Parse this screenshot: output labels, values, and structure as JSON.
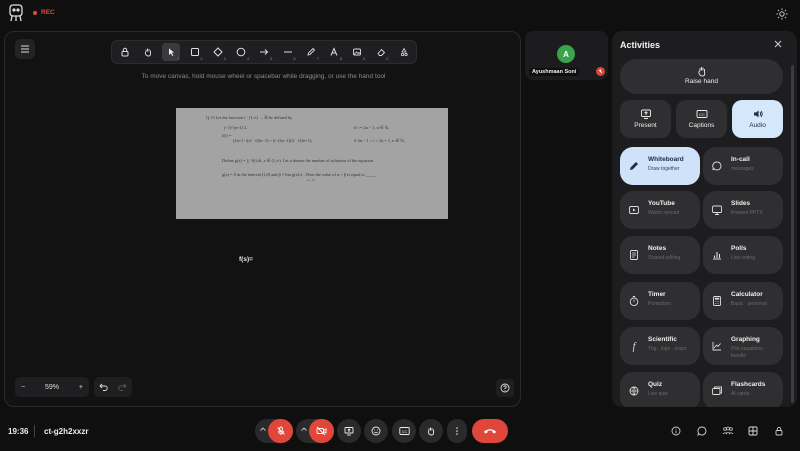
{
  "header": {
    "rec_label": "REC"
  },
  "canvas": {
    "hint": "To move canvas, hold mouse wheel or spacebar while dragging, or use the hand tool",
    "tool_numbers": [
      "",
      "",
      "1",
      "2",
      "3",
      "4",
      "5",
      "6",
      "7",
      "8",
      "9",
      "0",
      ""
    ],
    "selected_tool": "selection",
    "handwritten_text": "f(s)=",
    "zoom_level": "59%",
    "paper": {
      "line1": "Q.13   Let the function  f : [1,∞) → ℝ  be defined by",
      "line2a": "f(t) = ",
      "line2b": "(−1)^(n+1) 2,",
      "line2c": "if  t = 2n − 1,  n ∈ ℕ,",
      "line3a": "(2n+1−t)/2 · f(2n−1) + (t−(2n−1))/2 · f(2n+1),",
      "line3b": "if  2n − 1 < t < 2n + 1,  n ∈ ℕ.",
      "line4": "Define  g(x) = ∫₁ˣ f(t) dt,  x ∈ (1,∞).  Let  α  denote the number of solutions of the equation",
      "line5": "g(x) = 0  in the interval (1,8]  and   β = lim g(x)/x .  Then the value of  α + β  is equal to _____",
      "line5sub": "x→1+"
    }
  },
  "participant": {
    "initial": "A",
    "name": "Ayushmaan Soni"
  },
  "activities": {
    "title": "Activities",
    "raise_hand": "Raise hand",
    "quick": [
      {
        "label": "Present",
        "icon": "present-icon"
      },
      {
        "label": "Captions",
        "icon": "cc-icon"
      },
      {
        "label": "Audio",
        "icon": "speaker-icon"
      }
    ],
    "cards": [
      {
        "title": "Whiteboard",
        "sub": "Draw together",
        "icon": "pencil-icon"
      },
      {
        "title": "In-call",
        "sub": "messages",
        "icon": "chat-icon"
      },
      {
        "title": "YouTube",
        "sub": "Watch synced",
        "icon": "play-icon"
      },
      {
        "title": "Slides",
        "sub": "Present PPTX",
        "icon": "slides-icon"
      },
      {
        "title": "Notes",
        "sub": "Shared editing",
        "icon": "notes-icon"
      },
      {
        "title": "Polls",
        "sub": "Live voting",
        "icon": "bar-chart-icon"
      },
      {
        "title": "Timer",
        "sub": "Pomodoro",
        "icon": "timer-icon"
      },
      {
        "title": "Calculator",
        "sub": "Basic · personal",
        "icon": "calculator-icon"
      },
      {
        "title": "Scientific",
        "sub": "Trig · logs · exact",
        "icon": "function-icon"
      },
      {
        "title": "Graphing",
        "sub": "Plot equations · bundle",
        "icon": "graph-icon"
      },
      {
        "title": "Quiz",
        "sub": "Live quiz",
        "icon": "quiz-icon"
      },
      {
        "title": "Flashcards",
        "sub": "AI cards",
        "icon": "flashcards-icon"
      }
    ]
  },
  "footer": {
    "time": "19:36",
    "meeting_code": "ct-g2h2xxzr"
  }
}
